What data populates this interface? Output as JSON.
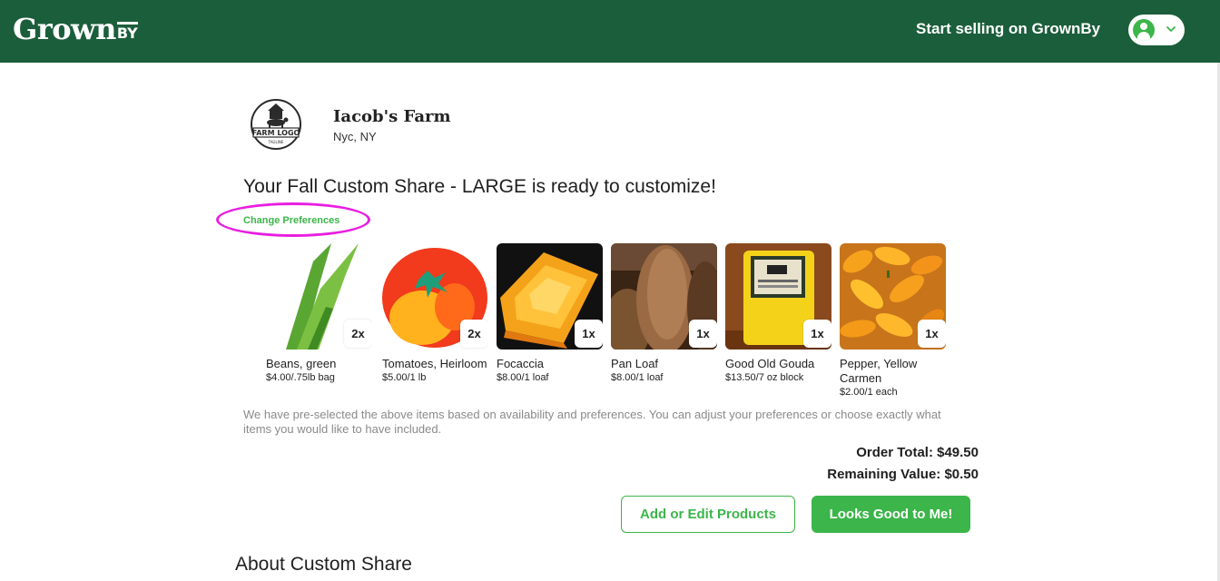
{
  "header": {
    "logo_text": "Grown",
    "logo_suffix": "BY",
    "sell_link": "Start selling on GrownBy",
    "icons": {
      "avatar": "user-avatar-icon",
      "menu": "chevron-down-icon"
    },
    "colors": {
      "header_bg": "#1b5e3b",
      "accent": "#3cb54a"
    }
  },
  "farm": {
    "logo_lines": [
      "FARM LOGO",
      "TAGLINE"
    ],
    "name": "Iacob's Farm",
    "location": "Nyc, NY"
  },
  "share": {
    "title": "Your Fall Custom Share - LARGE is ready to customize!",
    "change_prefs": "Change Preferences",
    "products": [
      {
        "name": "Beans, green",
        "price": "$4.00/.75lb bag",
        "qty": "2x"
      },
      {
        "name": "Tomatoes, Heirloom",
        "price": "$5.00/1 lb",
        "qty": "2x"
      },
      {
        "name": "Focaccia",
        "price": "$8.00/1 loaf",
        "qty": "1x"
      },
      {
        "name": "Pan Loaf",
        "price": "$8.00/1 loaf",
        "qty": "1x"
      },
      {
        "name": "Good Old Gouda",
        "price": "$13.50/7 oz block",
        "qty": "1x"
      },
      {
        "name": "Pepper, Yellow Carmen",
        "price": "$2.00/1 each",
        "qty": "1x"
      }
    ],
    "note": "We have pre-selected the above items based on availability and preferences. You can adjust your preferences or choose exactly what items you would like to have included.",
    "order_total": "Order Total: $49.50",
    "remaining_value": "Remaining Value: $0.50",
    "edit_button": "Add or Edit Products",
    "confirm_button": "Looks Good to Me!"
  },
  "about": {
    "title": "About Custom Share"
  }
}
